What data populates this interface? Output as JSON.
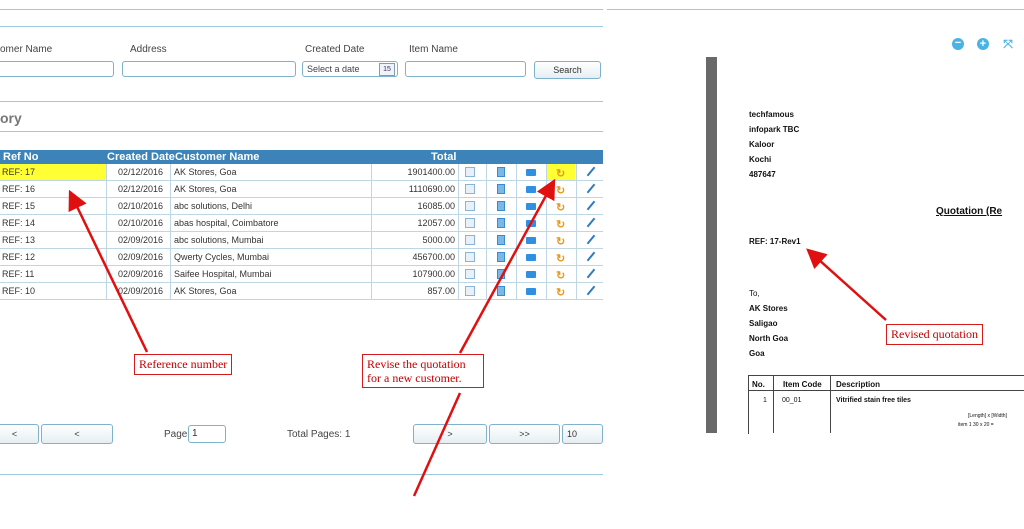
{
  "search": {
    "labels": {
      "customer_name": "omer Name",
      "address": "Address",
      "created_date": "Created Date",
      "item_name": "Item Name"
    },
    "date_placeholder": "Select a date",
    "calendar_icon_text": "15",
    "search_label": "Search"
  },
  "section_title": "ory",
  "table": {
    "headers": {
      "ref": "Ref No",
      "date": "Created Date",
      "customer": "Customer Name",
      "total": "Total"
    },
    "rows": [
      {
        "ref": "REF: 17",
        "date": "02/12/2016",
        "customer": "AK Stores, Goa",
        "total": "1901400.00"
      },
      {
        "ref": "REF: 16",
        "date": "02/12/2016",
        "customer": "AK Stores, Goa",
        "total": "1110690.00"
      },
      {
        "ref": "REF: 15",
        "date": "02/10/2016",
        "customer": "abc solutions, Delhi",
        "total": "16085.00"
      },
      {
        "ref": "REF: 14",
        "date": "02/10/2016",
        "customer": "abas hospital, Coimbatore",
        "total": "12057.00"
      },
      {
        "ref": "REF: 13",
        "date": "02/09/2016",
        "customer": "abc solutions, Mumbai",
        "total": "5000.00"
      },
      {
        "ref": "REF: 12",
        "date": "02/09/2016",
        "customer": "Qwerty Cycles, Mumbai",
        "total": "456700.00"
      },
      {
        "ref": "REF: 11",
        "date": "02/09/2016",
        "customer": "Saifee Hospital, Mumbai",
        "total": "107900.00"
      },
      {
        "ref": "REF: 10",
        "date": "02/09/2016",
        "customer": "AK Stores, Goa",
        "total": "857.00"
      }
    ]
  },
  "pager": {
    "first_label": "<",
    "prev_label": "<",
    "page_label": "Page:",
    "page_value": "1",
    "total_pages": "Total Pages: 1",
    "next_label": ">",
    "last_label": ">>",
    "page_size": "10"
  },
  "annotations": {
    "reference_number": "Reference number",
    "revise_line1": "Revise the quotation",
    "revise_line2": "for a new customer.",
    "revised_quotation": "Revised quotation"
  },
  "viewer": {
    "toolbar_icons": [
      "zoom-out-icon",
      "zoom-in-icon",
      "fit-page-icon"
    ],
    "company": [
      "techfamous",
      "infopark TBC",
      "Kaloor",
      "Kochi",
      "487647"
    ],
    "doc_title": "Quotation (Re",
    "ref": "REF: 17-Rev1",
    "to_label": "To,",
    "recipient": [
      "AK Stores",
      "Saligao",
      "North Goa",
      "Goa"
    ],
    "items_headers": {
      "no": "No.",
      "code": "Item Code",
      "desc": "Description"
    },
    "item": {
      "no": "1",
      "code": "00_01",
      "desc": "Vitrified stain free tiles"
    },
    "dims_line1": "[Length] x [Width]",
    "dims_line2": "item 1  30 x 20 ="
  },
  "colors": {
    "header": "#3b83b8",
    "highlight": "#ffff33",
    "annotation": "#d41a1a",
    "accent": "#4ab3e6"
  }
}
